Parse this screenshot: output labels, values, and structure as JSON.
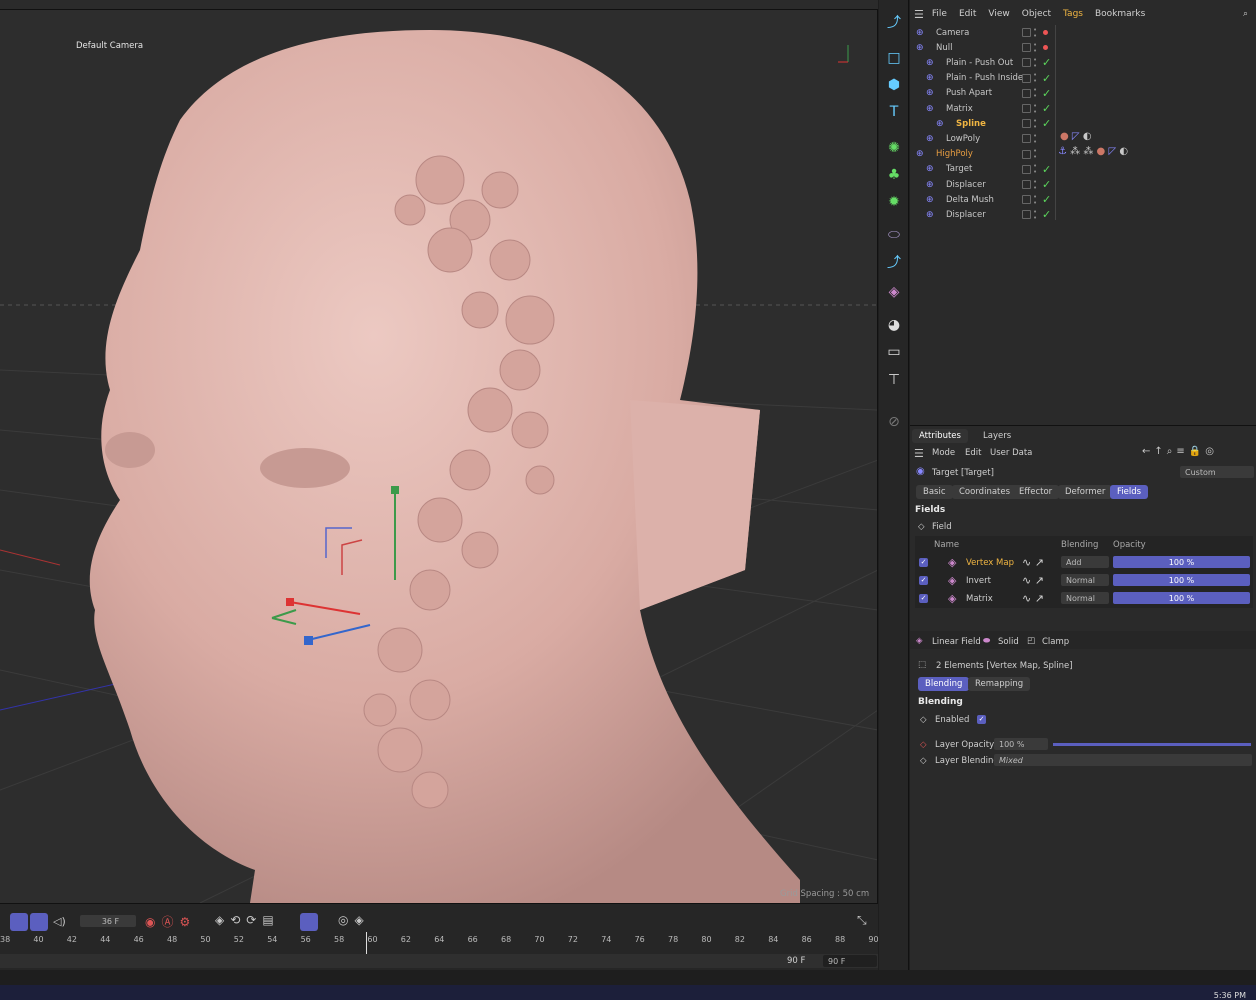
{
  "viewport": {
    "title": "Default Camera",
    "grid_spacing": "Grid Spacing : 50 cm"
  },
  "objects_menu": [
    "File",
    "Edit",
    "View",
    "Object",
    "Tags",
    "Bookmarks"
  ],
  "objects": [
    {
      "name": "Camera",
      "indent": 0,
      "state": "red"
    },
    {
      "name": "Null",
      "indent": 0,
      "state": "red"
    },
    {
      "name": "Plain - Push Out",
      "indent": 1,
      "state": "check"
    },
    {
      "name": "Plain - Push Inside",
      "indent": 1,
      "state": "check"
    },
    {
      "name": "Push Apart",
      "indent": 1,
      "state": "check"
    },
    {
      "name": "Matrix",
      "indent": 1,
      "state": "check"
    },
    {
      "name": "Spline",
      "indent": 2,
      "state": "check"
    },
    {
      "name": "LowPoly",
      "indent": 1,
      "state": "none"
    },
    {
      "name": "HighPoly",
      "indent": 0,
      "state": "none"
    },
    {
      "name": "Target",
      "indent": 1,
      "state": "check"
    },
    {
      "name": "Displacer",
      "indent": 1,
      "state": "check"
    },
    {
      "name": "Delta Mush",
      "indent": 1,
      "state": "check"
    },
    {
      "name": "Displacer",
      "indent": 1,
      "state": "check"
    }
  ],
  "attributes": {
    "tabs": [
      "Attributes",
      "Layers"
    ],
    "menu": [
      "Mode",
      "Edit",
      "User Data"
    ],
    "object_title": "Target [Target]",
    "preset": "Custom",
    "subtabs": [
      "Basic",
      "Coordinates",
      "Effector",
      "Deformer",
      "Fields"
    ],
    "section_fields": "Fields",
    "field_label": "Field",
    "columns": {
      "name": "Name",
      "blending": "Blending",
      "opacity": "Opacity"
    },
    "fields": [
      {
        "name": "Vertex Map",
        "blending": "Add",
        "opacity": "100 %"
      },
      {
        "name": "Invert",
        "blending": "Normal",
        "opacity": "100 %"
      },
      {
        "name": "Matrix",
        "blending": "Normal",
        "opacity": "100 %"
      }
    ],
    "field_buttons": [
      "Linear Field",
      "Solid",
      "Clamp"
    ],
    "elements_info": "2 Elements [Vertex Map, Spline]",
    "blend_tabs": [
      "Blending",
      "Remapping"
    ],
    "section_blending": "Blending",
    "enabled_label": "Enabled",
    "layer_opacity_label": "Layer Opacity",
    "layer_opacity_value": "100 %",
    "layer_blending_label": "Layer Blending",
    "layer_blending_value": "Mixed"
  },
  "timeline": {
    "current_frame": "36 F",
    "end_frame_a": "90 F",
    "end_frame_b": "90 F",
    "ticks": [
      "38",
      "40",
      "42",
      "44",
      "46",
      "48",
      "50",
      "52",
      "54",
      "56",
      "58",
      "60",
      "62",
      "64",
      "66",
      "68",
      "70",
      "72",
      "74",
      "76",
      "78",
      "80",
      "82",
      "84",
      "86",
      "88",
      "90"
    ]
  },
  "clock": "5:36 PM",
  "colors": {
    "accent": "#5b5fbf",
    "highlight": "#f0b542",
    "skin": "#e0b8b0"
  }
}
